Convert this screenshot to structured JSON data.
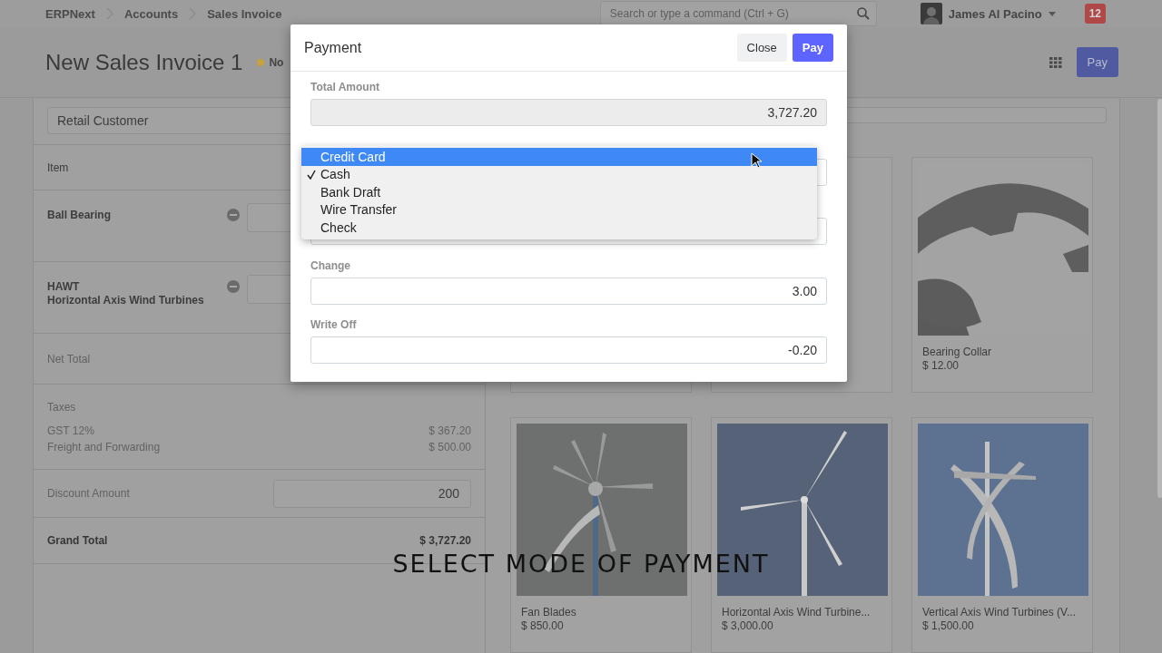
{
  "navbar": {
    "breadcrumbs": [
      "ERPNext",
      "Accounts",
      "Sales Invoice"
    ],
    "search": {
      "placeholder": "Search or type a command (Ctrl + G)"
    },
    "user": {
      "name": "James Al Pacino"
    },
    "notifications": "12"
  },
  "page": {
    "title": "New Sales Invoice 1",
    "status": {
      "label": "No",
      "color": "#c8a03c"
    },
    "primary_button": "Pay"
  },
  "customer_field": {
    "value": "Retail Customer"
  },
  "items_table": {
    "header": "Item",
    "rows": [
      {
        "name": "Ball Bearing"
      },
      {
        "name": "HAWT",
        "description": "Horizontal Axis Wind Turbines"
      }
    ]
  },
  "totals": {
    "net_total_label": "Net Total",
    "taxes_label": "Taxes",
    "taxes": [
      {
        "name": "GST 12%",
        "amount": "$ 367.20"
      },
      {
        "name": "Freight and Forwarding",
        "amount": "$ 500.00"
      }
    ],
    "discount": {
      "label": "Discount Amount",
      "value": "200"
    },
    "grand_total": {
      "label": "Grand Total",
      "value": "$ 3,727.20"
    }
  },
  "products": [
    {
      "kind": "covered"
    },
    {
      "kind": "covered"
    },
    {
      "kind": "picture",
      "name": "Bearing Collar",
      "price": "$ 12.00"
    },
    {
      "kind": "picture",
      "name": "Fan Blades",
      "price": "$ 850.00"
    },
    {
      "kind": "picture",
      "name": "Horizontal Axis Wind Turbine...",
      "price": "$ 3,000.00"
    },
    {
      "kind": "picture",
      "name": "Vertical Axis Wind Turbines (V...",
      "price": "$ 1,500.00"
    }
  ],
  "dialog": {
    "title": "Payment",
    "buttons": [
      {
        "label": "Close",
        "kind": "default"
      },
      {
        "label": "Pay",
        "kind": "primary"
      }
    ],
    "fields": [
      {
        "label": "Total Amount",
        "value": "3,727.20",
        "readonly": true
      },
      {
        "readonly": false
      },
      {
        "readonly": false
      },
      {
        "label": "Change",
        "value": "3.00",
        "readonly": false
      },
      {
        "label": "Write Off",
        "value": "-0.20",
        "readonly": false
      }
    ]
  },
  "dropdown": {
    "options": [
      {
        "label": "Credit Card",
        "selected": true,
        "checked": false
      },
      {
        "label": "Cash",
        "selected": false,
        "checked": true
      },
      {
        "label": "Bank Draft",
        "selected": false,
        "checked": false
      },
      {
        "label": "Wire Transfer",
        "selected": false,
        "checked": false
      },
      {
        "label": "Check",
        "selected": false,
        "checked": false
      }
    ]
  },
  "caption": "SELECT MODE OF PAYMENT"
}
